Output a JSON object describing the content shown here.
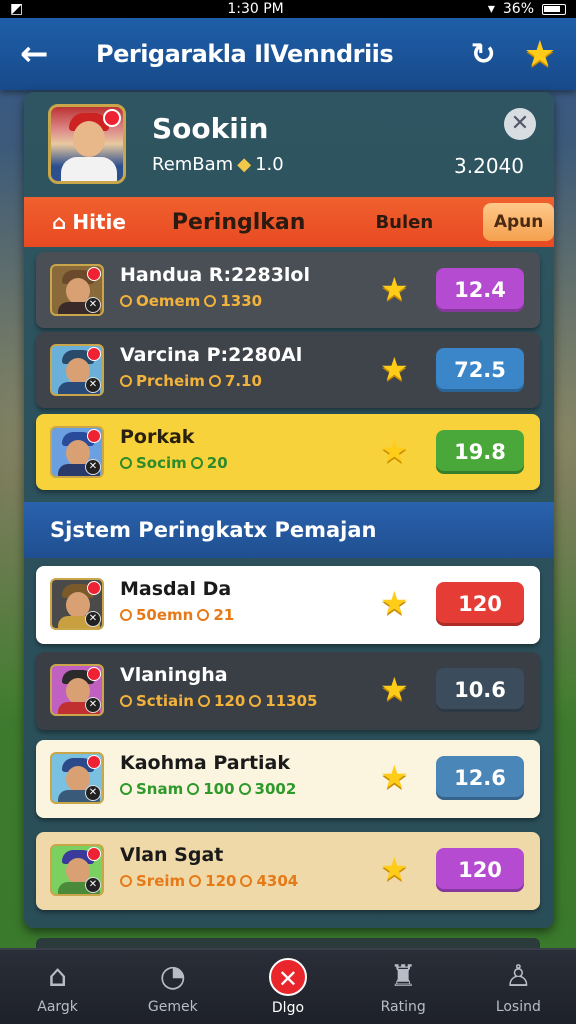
{
  "status": {
    "time": "1:30 PM",
    "battery": "36%"
  },
  "header": {
    "title": "Perigarakla IlVenndriis"
  },
  "profile": {
    "name": "Sookiin",
    "rank_label": "RemBam",
    "rank_value": "1.0",
    "score": "3.2040"
  },
  "tabs": {
    "hitlist": "Hitie",
    "peringkat": "Peringlkan",
    "bulan": "Bulen",
    "apun": "Apun"
  },
  "top_rows": [
    {
      "name": "Handua R:2283lol",
      "sub1": "Oemem",
      "sub2": "1330",
      "score": "12.4",
      "bg": "#4a4f55",
      "score_bg": "#b54bd1",
      "name_color": "#ffffff",
      "sub_color": "#f3b23a"
    },
    {
      "name": "Varcina P:2280Al",
      "sub1": "Prcheim",
      "sub2": "7.10",
      "score": "72.5",
      "bg": "#3f444a",
      "score_bg": "#3a86c8",
      "name_color": "#ffffff",
      "sub_color": "#f3b23a"
    },
    {
      "name": "Porkak",
      "sub1": "Socim",
      "sub2": "20",
      "score": "19.8",
      "bg": "#f7d23a",
      "score_bg": "#4aa83a",
      "name_color": "#2a2010",
      "sub_color": "#2e8a2a"
    }
  ],
  "section": {
    "title": "Sjstem Peringkatx Pemajan"
  },
  "system_rows": [
    {
      "name": "Masdal Da",
      "sub1": "50emn",
      "sub2": "21",
      "sub3": "",
      "score": "120",
      "bg": "#ffffff",
      "score_bg": "#e63c36",
      "name_color": "#1a1a1a",
      "sub_color": "#e67a18"
    },
    {
      "name": "Vlaningha",
      "sub1": "Sctiain",
      "sub2": "120",
      "sub3": "11305",
      "score": "10.6",
      "bg": "#3a3f46",
      "score_bg": "#3b4c5c",
      "name_color": "#ffffff",
      "sub_color": "#f3b23a"
    },
    {
      "name": "Kaohma Partiak",
      "sub1": "Snam",
      "sub2": "100",
      "sub3": "3002",
      "score": "12.6",
      "bg": "#fbf4df",
      "score_bg": "#4a86b8",
      "name_color": "#1a1a1a",
      "sub_color": "#2e9a2a"
    },
    {
      "name": "Vlan Sgat",
      "sub1": "Sreim",
      "sub2": "120",
      "sub3": "4304",
      "score": "120",
      "bg": "#f0d9a8",
      "score_bg": "#b54bd1",
      "name_color": "#1a1a1a",
      "sub_color": "#e67a18"
    }
  ],
  "nav": [
    {
      "label": "Aargk",
      "icon": "home-icon"
    },
    {
      "label": "Gemek",
      "icon": "ball-icon"
    },
    {
      "label": "Dlgo",
      "icon": "close-icon"
    },
    {
      "label": "Rating",
      "icon": "trophy-icon"
    },
    {
      "label": "Losind",
      "icon": "user-icon"
    }
  ]
}
